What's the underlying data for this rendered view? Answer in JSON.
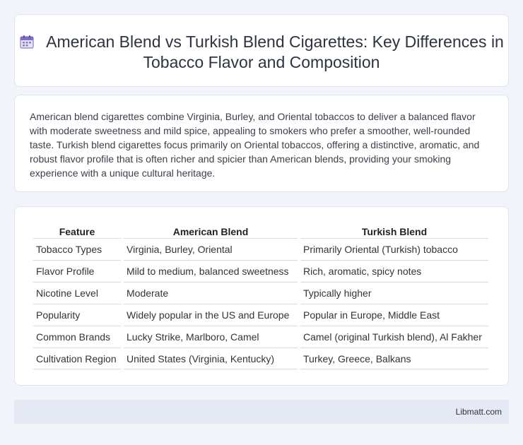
{
  "header": {
    "title": "American Blend vs Turkish Blend Cigarettes: Key Differences in Tobacco Flavor and Composition",
    "icon": "calendar-icon"
  },
  "intro": {
    "text": "American blend cigarettes combine Virginia, Burley, and Oriental tobaccos to deliver a balanced flavor with moderate sweetness and mild spice, appealing to smokers who prefer a smoother, well-rounded taste. Turkish blend cigarettes focus primarily on Oriental tobaccos, offering a distinctive, aromatic, and robust flavor profile that is often richer and spicier than American blends, providing your smoking experience with a unique cultural heritage."
  },
  "table": {
    "headers": [
      "Feature",
      "American Blend",
      "Turkish Blend"
    ],
    "rows": [
      [
        "Tobacco Types",
        "Virginia, Burley, Oriental",
        "Primarily Oriental (Turkish) tobacco"
      ],
      [
        "Flavor Profile",
        "Mild to medium, balanced sweetness",
        "Rich, aromatic, spicy notes"
      ],
      [
        "Nicotine Level",
        "Moderate",
        "Typically higher"
      ],
      [
        "Popularity",
        "Widely popular in the US and Europe",
        "Popular in Europe, Middle East"
      ],
      [
        "Common Brands",
        "Lucky Strike, Marlboro, Camel",
        "Camel (original Turkish blend), Al Fakher"
      ],
      [
        "Cultivation Region",
        "United States (Virginia, Kentucky)",
        "Turkey, Greece, Balkans"
      ]
    ]
  },
  "footer": {
    "brand": "Libmatt.com"
  }
}
